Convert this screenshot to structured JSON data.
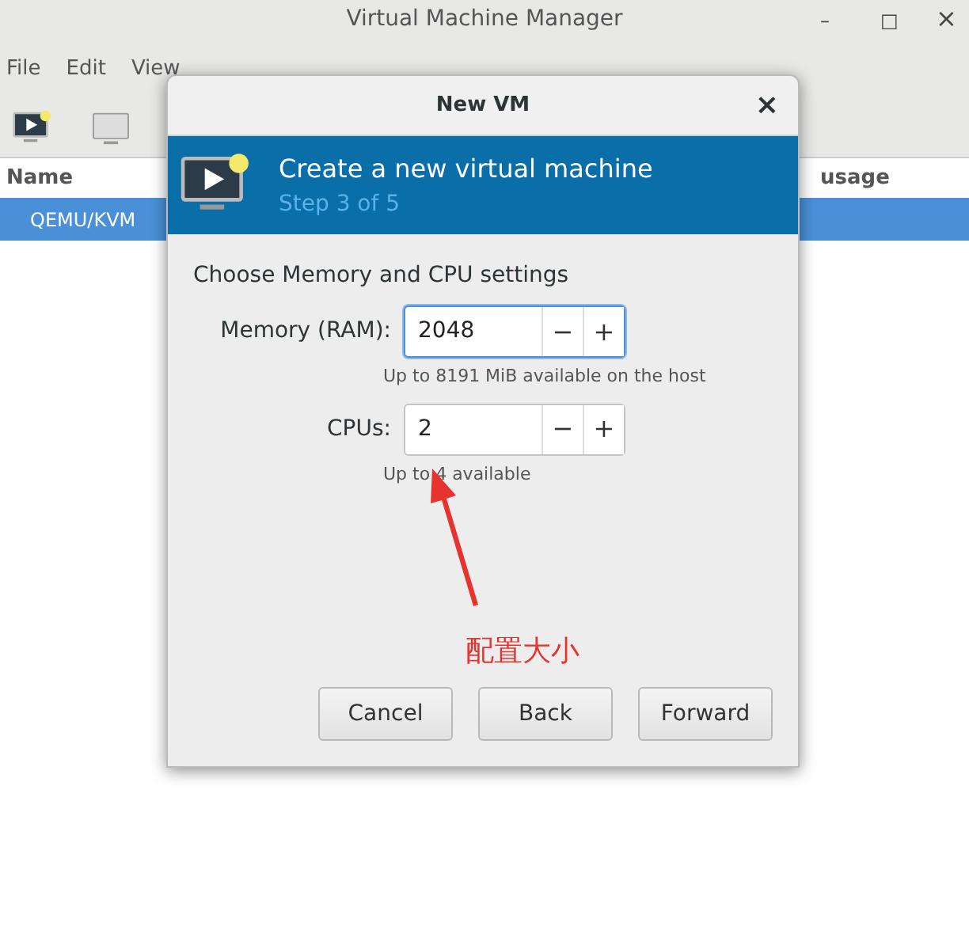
{
  "window": {
    "title": "Virtual Machine Manager",
    "controls": [
      "–",
      "□",
      "×"
    ]
  },
  "menu": [
    "File",
    "Edit",
    "View"
  ],
  "table": {
    "columns": [
      "Name",
      "usage"
    ],
    "rows": [
      {
        "name": "QEMU/KVM",
        "selected": true
      }
    ]
  },
  "dialog": {
    "title": "New VM",
    "close": "×",
    "minus": "−",
    "plus": "+",
    "banner_title": "Create a new virtual machine",
    "banner_step": "Step 3 of 5",
    "section": "Choose Memory and CPU settings",
    "fields": [
      {
        "label": "Memory (RAM):",
        "value": "2048",
        "hint": "Up to 8191 MiB available on the host",
        "focused": true
      },
      {
        "label": "CPUs:",
        "value": "2",
        "hint": "Up to 4 available",
        "focused": false
      }
    ],
    "buttons": [
      "Cancel",
      "Back",
      "Forward"
    ]
  },
  "annotation": {
    "text": "配置大小",
    "color": "#e8322e"
  }
}
